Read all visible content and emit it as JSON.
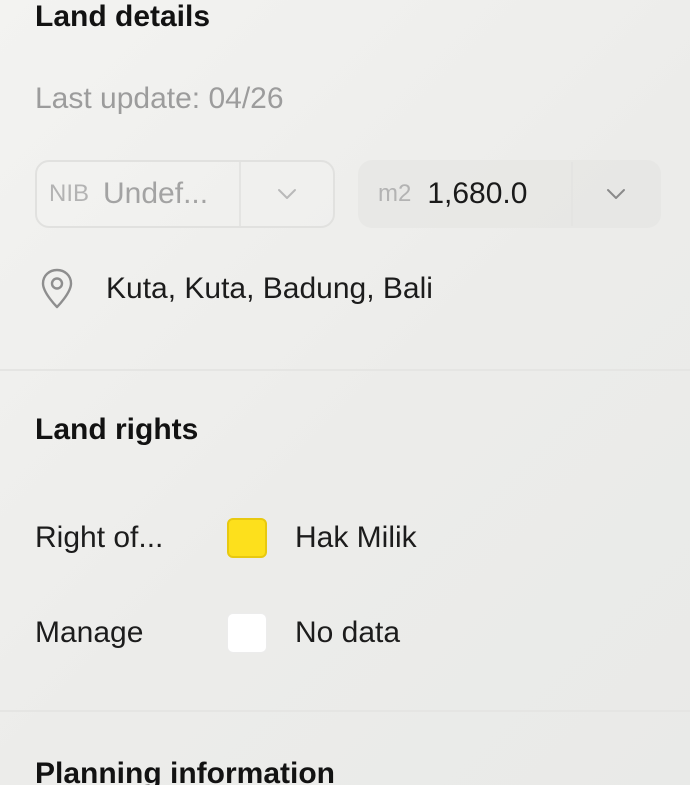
{
  "land_details": {
    "title": "Land details",
    "last_update": "Last update: 04/26",
    "nib": {
      "unit": "NIB",
      "value": "Undef..."
    },
    "area": {
      "unit": "m2",
      "value": "1,680.0"
    },
    "location": {
      "icon": "location-pin-icon",
      "text": "Kuta, Kuta, Badung, Bali"
    }
  },
  "land_rights": {
    "title": "Land rights",
    "rows": [
      {
        "label": "Right of...",
        "value": "Hak Milik",
        "color": "#fde01c"
      },
      {
        "label": "Manage",
        "value": "No data",
        "color": "#ffffff"
      }
    ]
  },
  "planning_information": {
    "title": "Planning information"
  }
}
